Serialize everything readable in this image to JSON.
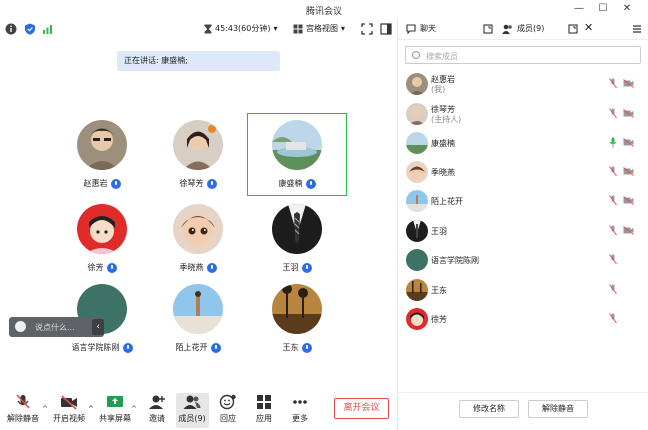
{
  "app": {
    "title": "腾讯会议"
  },
  "toolbar": {
    "timer": "45:43(60分钟)",
    "view_label": "宫格视图"
  },
  "speaking_banner": "正在讲话: 康盛楠;",
  "participants": [
    {
      "name": "赵惠岩"
    },
    {
      "name": "徐琴芳"
    },
    {
      "name": "康盛楠"
    },
    {
      "name": "徐芳"
    },
    {
      "name": "季晓燕"
    },
    {
      "name": "王羽"
    },
    {
      "name": "语言学院陈刚"
    },
    {
      "name": "陌上花开"
    },
    {
      "name": "王东"
    }
  ],
  "chat_input": {
    "placeholder": "说点什么..."
  },
  "bottom_bar": {
    "mute": "解除静音",
    "video": "开启视频",
    "share": "共享屏幕",
    "invite": "邀请",
    "members": "成员(9)",
    "react": "回应",
    "apps": "应用",
    "more": "更多",
    "leave": "离开会议"
  },
  "panel": {
    "tab_chat": "聊天",
    "tab_members": "成员(9)",
    "search_placeholder": "搜索成员",
    "members": [
      {
        "name": "赵惠岩",
        "sub": "(我)"
      },
      {
        "name": "徐琴芳",
        "sub": "(主持人)"
      },
      {
        "name": "康盛楠",
        "sub": ""
      },
      {
        "name": "季晓燕",
        "sub": ""
      },
      {
        "name": "陌上花开",
        "sub": ""
      },
      {
        "name": "王羽",
        "sub": ""
      },
      {
        "name": "语言学院陈刚",
        "sub": ""
      },
      {
        "name": "王东",
        "sub": ""
      },
      {
        "name": "徐芳",
        "sub": ""
      }
    ],
    "rename_button": "修改名称",
    "unmute_button": "解除静音"
  },
  "colors": {
    "accent": "#2b6de5",
    "active_speaker": "#2db84d",
    "leave": "#e34d4d",
    "muted": "#e34d4d"
  }
}
